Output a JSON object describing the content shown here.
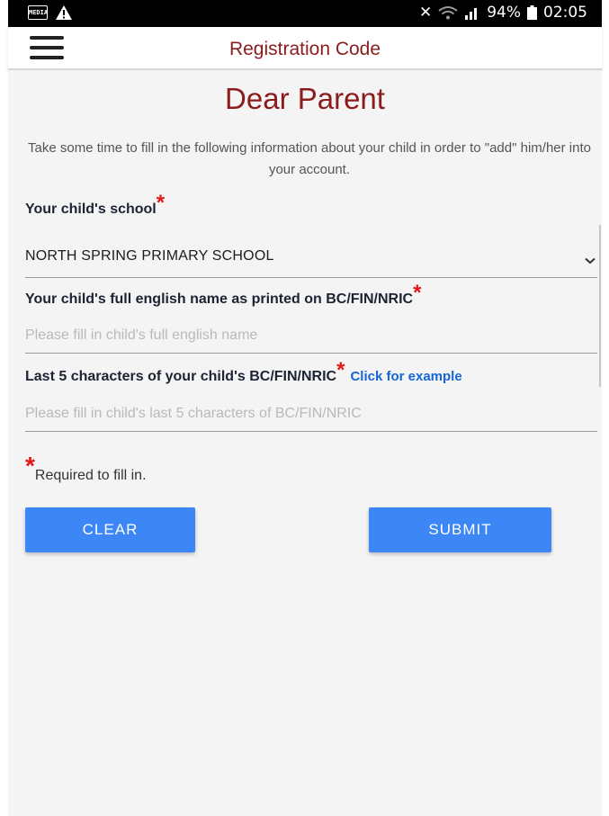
{
  "status_bar": {
    "app_badge": "MEDIA",
    "mute_glyph": "✕",
    "battery": "94%",
    "time": "02:05"
  },
  "app_bar": {
    "title": "Registration Code"
  },
  "page": {
    "heading": "Dear Parent",
    "intro": "Take some time to fill in the following information about your child in order to \"add\" him/her into your account."
  },
  "form": {
    "school": {
      "label": "Your child's school",
      "value": "NORTH SPRING PRIMARY SCHOOL"
    },
    "name": {
      "label": "Your child's full english name as printed on BC/FIN/NRIC",
      "placeholder": "Please fill in child's full english name"
    },
    "id": {
      "label": "Last 5 characters of your child's BC/FIN/NRIC",
      "link": "Click for example",
      "placeholder": "Please fill in child's last 5 characters of BC/FIN/NRIC"
    },
    "required_star": "*",
    "required_note": "Required to fill in."
  },
  "buttons": {
    "clear": "CLEAR",
    "submit": "SUBMIT"
  },
  "colors": {
    "accent_title": "#8b1c1c",
    "button_blue": "#3d86f6",
    "link_blue": "#1565d8",
    "required_red": "#e31818"
  }
}
